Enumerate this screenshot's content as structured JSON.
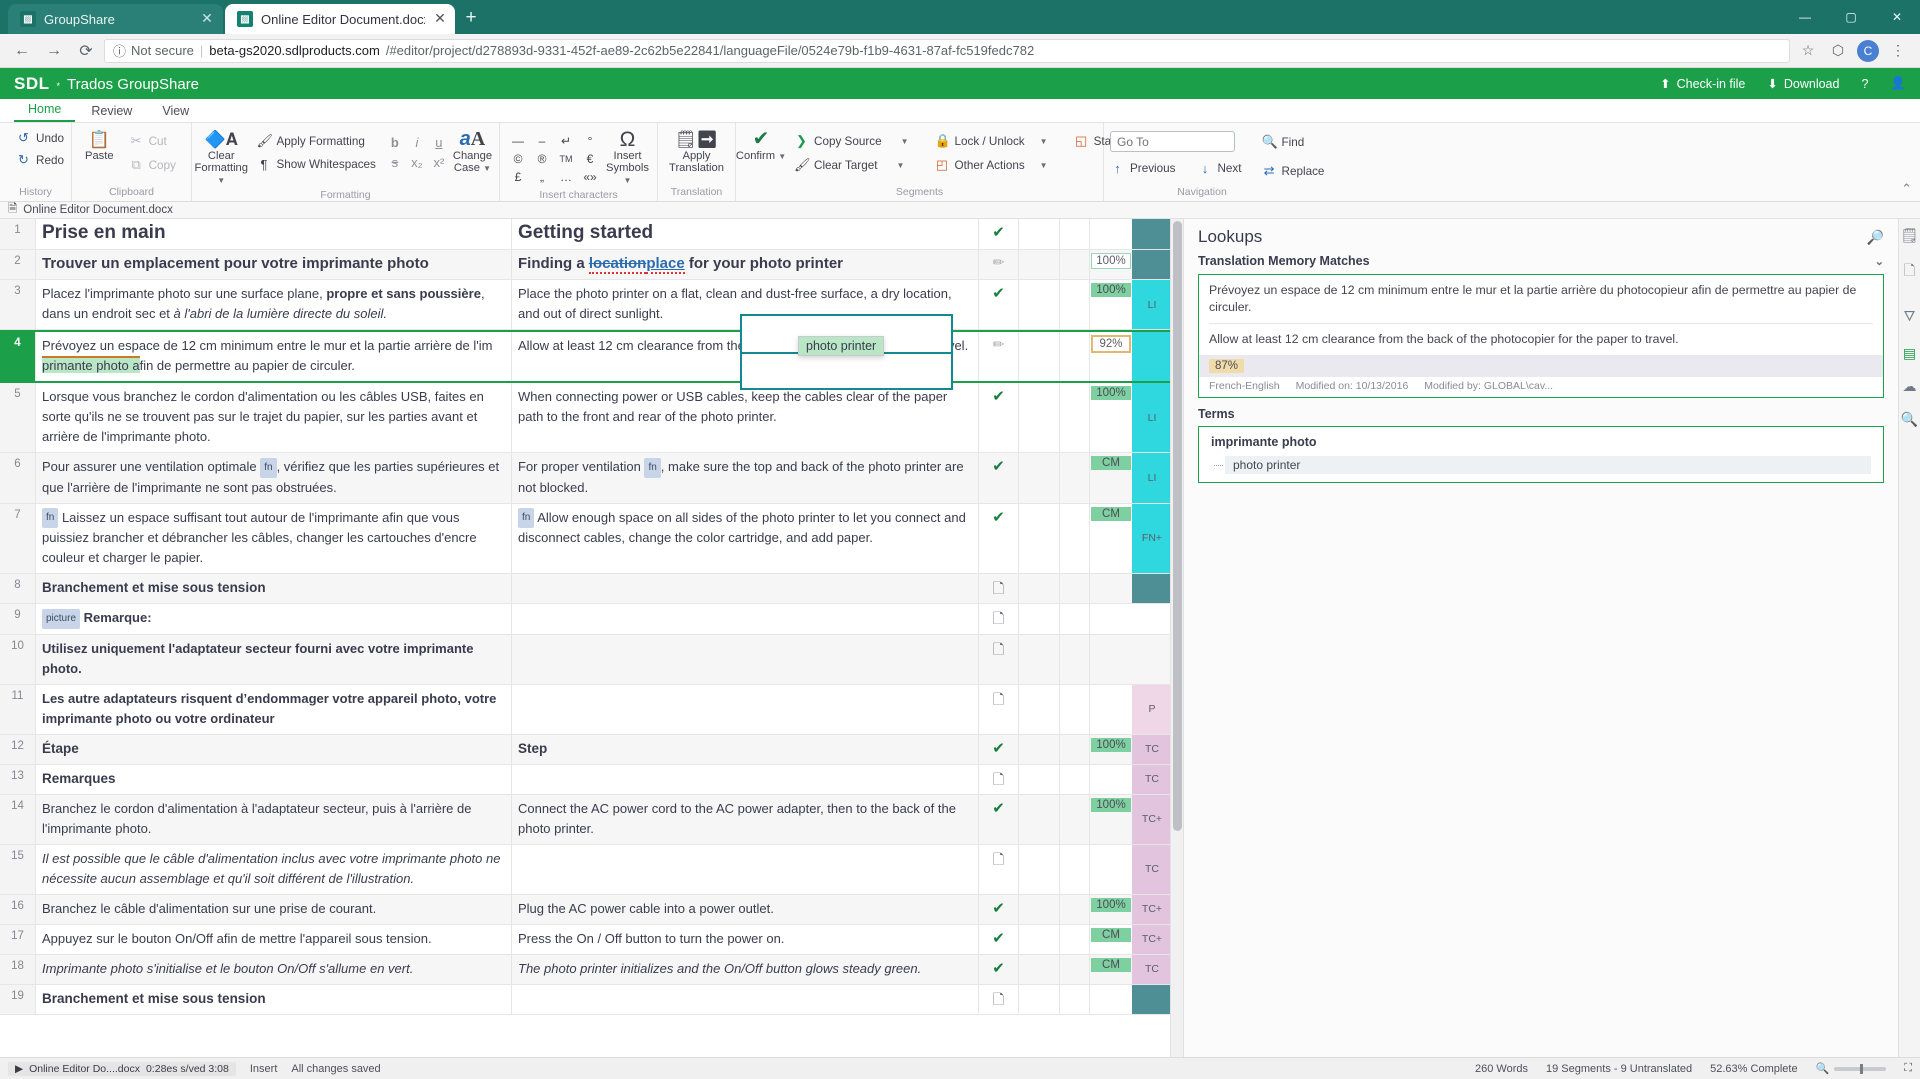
{
  "browser": {
    "tabs": [
      {
        "title": "GroupShare",
        "favicon": "trados-icon",
        "active": false
      },
      {
        "title": "Online Editor Document.docx.sd",
        "favicon": "trados-icon",
        "active": true
      }
    ],
    "new_tab_label": "+",
    "window_controls": [
      "minimize",
      "maximize",
      "close"
    ],
    "nav": {
      "back": "back-icon",
      "forward": "forward-icon",
      "reload": "reload-icon"
    },
    "omnibox": {
      "security_label": "Not secure",
      "url_host": "beta-gs2020.sdlproducts.com",
      "url_path": "/#editor/project/d278893d-9331-452f-ae89-2c62b5e22841/languageFile/0524e79b-f1b9-4631-87af-fc519fedc782"
    },
    "toolbar_icons": [
      "star-icon",
      "extension-icon",
      "profile-avatar",
      "menu-icon"
    ],
    "profile_initial": "C"
  },
  "app": {
    "brand_sdl": "SDL",
    "brand_sup": "*",
    "brand_product": "Trados GroupShare",
    "header_actions": [
      {
        "label": "Check-in file",
        "icon": "upload-icon"
      },
      {
        "label": "Download",
        "icon": "download-icon"
      },
      {
        "label": "",
        "icon": "help-icon"
      },
      {
        "label": "",
        "icon": "user-icon"
      }
    ]
  },
  "ribbon": {
    "tabs": [
      {
        "label": "Home",
        "active": true
      },
      {
        "label": "Review",
        "active": false
      },
      {
        "label": "View",
        "active": false
      }
    ],
    "collapse_icon": "chevron-up-icon",
    "groups": [
      {
        "name": "History",
        "buttons": [
          {
            "label": "Undo",
            "icon": "undo-icon",
            "disabled": false
          },
          {
            "label": "Redo",
            "icon": "redo-icon",
            "disabled": false
          }
        ]
      },
      {
        "name": "Clipboard",
        "big": {
          "label": "Paste",
          "icon": "paste-icon"
        },
        "buttons": [
          {
            "label": "Cut",
            "icon": "scissors-icon",
            "disabled": true
          },
          {
            "label": "Copy",
            "icon": "copy-icon",
            "disabled": true
          }
        ]
      },
      {
        "name": "Formatting",
        "big": {
          "label": "Clear Formatting",
          "icon": "clear-formatting-icon",
          "caret": true
        },
        "buttons": [
          {
            "label": "Apply Formatting",
            "icon": "format-painter-icon"
          },
          {
            "label": "Show Whitespaces",
            "icon": "pilcrow-icon"
          }
        ],
        "format_glyphs": [
          "b",
          "i",
          "u",
          "s",
          "x₂",
          "x²"
        ],
        "change_case": {
          "label": "Change Case",
          "icon": "aA-icon",
          "caret": true
        }
      },
      {
        "name": "Insert characters",
        "char_glyphs": [
          "—",
          "–",
          "↵",
          "°",
          "©",
          "®",
          "TM",
          "€",
          "£",
          "„",
          "…",
          "«»"
        ],
        "big": {
          "label": "Insert Symbols",
          "icon": "omega-icon",
          "caret": true
        }
      },
      {
        "name": "Translation",
        "big": {
          "label": "Apply Translation",
          "icon": "apply-translation-icon"
        }
      },
      {
        "name": "Segments",
        "big": {
          "label": "Confirm",
          "icon": "check-icon",
          "caret": true
        },
        "buttons": [
          {
            "label": "Copy Source",
            "icon": "copy-source-icon",
            "caret": true
          },
          {
            "label": "Clear Target",
            "icon": "clear-target-icon",
            "caret": true
          },
          {
            "label": "Lock / Unlock",
            "icon": "lock-icon",
            "caret": true
          },
          {
            "label": "Other Actions",
            "icon": "other-actions-icon",
            "caret": true
          },
          {
            "label": "Status",
            "icon": "status-icon",
            "caret": true
          }
        ]
      },
      {
        "name": "Navigation",
        "goto_placeholder": "Go To",
        "goto_value": "",
        "buttons": [
          {
            "label": "Find",
            "icon": "search-icon"
          },
          {
            "label": "Replace",
            "icon": "replace-icon"
          },
          {
            "label": "Previous",
            "icon": "arrow-up-icon"
          },
          {
            "label": "Next",
            "icon": "arrow-down-icon"
          }
        ]
      }
    ]
  },
  "document": {
    "tab_label": "Online Editor Document.docx",
    "tab_icon": "document-icon"
  },
  "segments": [
    {
      "num": "1",
      "source_html": "<span class=\"head1\">Prise en main</span>",
      "target_html": "<span class=\"head1\">Getting started</span>",
      "source_text": "Prise en main",
      "target_text": "Getting started",
      "status": "confirmed",
      "match": "",
      "match_style": "",
      "tag": "",
      "tag_style": "tag-dark",
      "alt": false
    },
    {
      "num": "2",
      "source_html": "<span class=\"head2\">Trouver un emplacement pour votre imprimante photo</span>",
      "target_html": "<span class=\"head2\">Finding a <span class=\"trk-del sq\">location</span><span class=\"trk-ins sq\">place</span> for your photo printer</span>",
      "source_text": "Trouver un emplacement pour votre imprimante photo",
      "target_text": "Finding a locationplace for your photo printer",
      "status": "draft",
      "match": "100%",
      "match_style": "pct-outline",
      "tag": "",
      "tag_style": "tag-dark",
      "alt": true
    },
    {
      "num": "3",
      "source_html": "Placez l'imprimante photo sur une surface plane, <b class=\"bb\">propre et sans poussière</b>, dans un endroit sec et <i class=\"ii\">à l'abri de la lumière directe du soleil.</i>",
      "target_html": "Place the photo printer on a flat, clean and dust-free surface, a dry location, and out of direct sunlight.",
      "source_text": "Placez l'imprimante photo sur une surface plane, propre et sans poussière, dans un endroit sec et à l'abri de la lumière directe du soleil.",
      "target_text": "Place the photo printer on a flat, clean and dust-free surface, a dry location, and out of direct sunlight.",
      "status": "confirmed",
      "match": "100%",
      "match_style": "pct-green",
      "tag": "LI",
      "tag_style": "tag-li",
      "alt": false
    },
    {
      "num": "4",
      "source_html": "Prévoyez un espace de 12 cm minimum entre le mur et la partie arrière de l'im<br><span class=\"tm-hl\">primante photo a</span>fin de permettre au papier de circuler.",
      "target_html": "Allow at least 12 cm clearance from the back of the pho for the paper to travel.",
      "source_text": "Prévoyez un espace de 12 cm minimum entre le mur et la partie arrière de l'imprimante photo afin de permettre au papier de circuler.",
      "target_text": "Allow at least 12 cm clearance from the back of the pho for the paper to travel.",
      "status": "draft",
      "match": "92%",
      "match_style": "pct-amber",
      "tag": "",
      "tag_style": "tag-cy",
      "alt": false,
      "active": true,
      "autocomplete": "photo printer"
    },
    {
      "num": "5",
      "source_html": "Lorsque vous branchez le cordon d'alimentation ou les câbles USB, faites en sorte qu'ils ne se trouvent pas sur le trajet du papier, sur les parties avant et arrière de l'imprimante photo.",
      "target_html": "When connecting power or USB cables, keep the cables clear of the paper path to the front and rear of the photo printer.",
      "source_text": "Lorsque vous branchez le cordon d'alimentation ou les câbles USB, faites en sorte qu'ils ne se trouvent pas sur le trajet du papier, sur les parties avant et arrière de l'imprimante photo.",
      "target_text": "When connecting power or USB cables, keep the cables clear of the paper path to the front and rear of the photo printer.",
      "status": "confirmed",
      "match": "100%",
      "match_style": "pct-green",
      "tag": "LI",
      "tag_style": "tag-li",
      "alt": false
    },
    {
      "num": "6",
      "source_html": "Pour assurer une ventilation optimale <span class=\"tagchip\">fn</span>, vérifiez que les parties supérieures et que l'arrière de l'imprimante ne sont pas obstruées.",
      "target_html": "For proper ventilation <span class=\"tagchip\">fn</span>, make sure the top and back of the photo printer are not blocked.",
      "source_text": "Pour assurer une ventilation optimale fn, vérifiez que les parties supérieures et que l'arrière de l'imprimante ne sont pas obstruées.",
      "target_text": "For proper ventilation fn, make sure the top and back of the photo printer are not blocked.",
      "status": "confirmed",
      "match": "CM",
      "match_style": "pct-green",
      "tag": "LI",
      "tag_style": "tag-li",
      "alt": true
    },
    {
      "num": "7",
      "source_html": "<span class=\"tagchip\">fn</span> Laissez un espace suffisant tout autour de l'imprimante afin que vous puissiez brancher et débrancher les câbles, changer les cartouches d'encre couleur et charger le papier.",
      "target_html": "<span class=\"tagchip\">fn</span> Allow enough space on all sides of the photo printer to let you connect and disconnect cables, change the color cartridge, and add paper.",
      "source_text": "fn Laissez un espace suffisant tout autour de l'imprimante afin que vous puissiez brancher et débrancher les câbles, changer les cartouches d'encre couleur et charger le papier.",
      "target_text": "fn Allow enough space on all sides of the photo printer to let you connect and disconnect cables, change the color cartridge, and add paper.",
      "status": "confirmed",
      "match": "CM",
      "match_style": "pct-green",
      "tag": "FN+",
      "tag_style": "tag-li",
      "alt": false
    },
    {
      "num": "8",
      "source_html": "<span class=\"head3\">Branchement et mise sous tension</span>",
      "target_html": "",
      "source_text": "Branchement et mise sous tension",
      "target_text": "",
      "status": "untranslated",
      "match": "",
      "match_style": "",
      "tag": "",
      "tag_style": "tag-dark",
      "alt": true
    },
    {
      "num": "9",
      "source_html": "<span class=\"tagchip\">picture</span> <b class=\"bb\">Remarque:</b>",
      "target_html": "",
      "source_text": "picture Remarque:",
      "target_text": "",
      "status": "untranslated",
      "match": "",
      "match_style": "",
      "tag": "",
      "tag_style": "",
      "alt": false
    },
    {
      "num": "10",
      "source_html": "<b class=\"bb\">Utilisez uniquement l'adaptateur secteur fourni avec votre imprimante photo.</b>",
      "target_html": "",
      "source_text": "Utilisez uniquement l'adaptateur secteur fourni avec votre imprimante photo.",
      "target_text": "",
      "status": "untranslated",
      "match": "",
      "match_style": "",
      "tag": "",
      "tag_style": "",
      "alt": true
    },
    {
      "num": "11",
      "source_html": "<b class=\"bb\">Les autre adaptateurs risquent d’endommager votre appareil photo, votre imprimante photo ou votre ordinateur</b>",
      "target_html": "",
      "source_text": "Les autre adaptateurs risquent d’endommager votre appareil photo, votre imprimante photo ou votre ordinateur",
      "target_text": "",
      "status": "untranslated",
      "match": "",
      "match_style": "",
      "tag": "P",
      "tag_style": "tag-p",
      "alt": false
    },
    {
      "num": "12",
      "source_html": "<span class=\"head3\">Étape</span>",
      "target_html": "<span class=\"head3\">Step</span>",
      "source_text": "Étape",
      "target_text": "Step",
      "status": "confirmed",
      "match": "100%",
      "match_style": "pct-green",
      "tag": "TC",
      "tag_style": "tag-tc",
      "alt": true
    },
    {
      "num": "13",
      "source_html": "<span class=\"head3\">Remarques</span>",
      "target_html": "",
      "source_text": "Remarques",
      "target_text": "",
      "status": "untranslated",
      "match": "",
      "match_style": "",
      "tag": "TC",
      "tag_style": "tag-tc",
      "alt": false
    },
    {
      "num": "14",
      "source_html": "Branchez le cordon d'alimentation à l'adaptateur secteur, puis à l'arrière de l'imprimante photo.",
      "target_html": "Connect the AC power cord to the AC power adapter, then to the back of the photo printer.",
      "source_text": "Branchez le cordon d'alimentation à l'adaptateur secteur, puis à l'arrière de l'imprimante photo.",
      "target_text": "Connect the AC power cord to the AC power adapter, then to the back of the photo printer.",
      "status": "confirmed",
      "match": "100%",
      "match_style": "pct-green",
      "tag": "TC+",
      "tag_style": "tag-tc",
      "alt": true
    },
    {
      "num": "15",
      "source_html": "<i class=\"ii\">Il est possible que le câble d'alimentation inclus avec votre imprimante photo ne nécessite aucun assemblage et qu'il soit différent de l'illustration.</i>",
      "target_html": "",
      "source_text": "Il est possible que le câble d'alimentation inclus avec votre imprimante photo ne nécessite aucun assemblage et qu'il soit différent de l'illustration.",
      "target_text": "",
      "status": "untranslated",
      "match": "",
      "match_style": "",
      "tag": "TC",
      "tag_style": "tag-tc",
      "alt": false
    },
    {
      "num": "16",
      "source_html": "Branchez le câble d'alimentation sur une prise de courant.",
      "target_html": "Plug the AC power cable into a power outlet.",
      "source_text": "Branchez le câble d'alimentation sur une prise de courant.",
      "target_text": "Plug the AC power cable into a power outlet.",
      "status": "confirmed",
      "match": "100%",
      "match_style": "pct-green",
      "tag": "TC+",
      "tag_style": "tag-tc",
      "alt": true
    },
    {
      "num": "17",
      "source_html": "Appuyez sur le bouton On/Off afin de mettre l'appareil sous tension.",
      "target_html": "Press the On / Off button to turn the power on.",
      "source_text": "Appuyez sur le bouton On/Off afin de mettre l'appareil sous tension.",
      "target_text": "Press the On / Off button to turn the power on.",
      "status": "confirmed",
      "match": "CM",
      "match_style": "pct-green",
      "tag": "TC+",
      "tag_style": "tag-tc",
      "alt": false
    },
    {
      "num": "18",
      "source_html": "<i class=\"ii\">Imprimante photo s'initialise et le bouton On/Off s'allume en vert.</i>",
      "target_html": "<i class=\"ii\">The photo printer initializes and the On/Off button glows steady green.</i>",
      "source_text": "Imprimante photo s'initialise et le bouton On/Off s'allume en vert.",
      "target_text": "The photo printer initializes and the On/Off button glows steady green.",
      "status": "confirmed",
      "match": "CM",
      "match_style": "pct-green",
      "tag": "TC",
      "tag_style": "tag-tc",
      "alt": true
    },
    {
      "num": "19",
      "source_html": "<span class=\"head3\">Branchement et mise sous tension</span>",
      "target_html": "",
      "source_text": "Branchement et mise sous tension",
      "target_text": "",
      "status": "untranslated",
      "match": "",
      "match_style": "",
      "tag": "",
      "tag_style": "tag-dark",
      "alt": false
    }
  ],
  "lookups": {
    "title": "Lookups",
    "search_icon": "search-icon",
    "tm_section_title": "Translation Memory Matches",
    "collapse_icon": "chevron-down-icon",
    "tm_match": {
      "source": "Prévoyez un espace de 12 cm minimum entre le mur et la partie arrière du photocopieur afin de permettre au papier de circuler.",
      "target": "Allow at least 12 cm clearance from the back of the photocopier for the paper to travel.",
      "score": "87%",
      "language_pair": "French-English",
      "modified_on_label": "Modified on: 10/13/2016",
      "modified_by_label": "Modified by: GLOBAL\\cav..."
    },
    "terms_title": "Terms",
    "terms": [
      {
        "source": "imprimante photo",
        "target": "photo printer"
      }
    ]
  },
  "rail_icons": [
    "notes-icon",
    "comments-icon",
    "filter-icon",
    "tm-icon",
    "messages-icon",
    "search2-icon"
  ],
  "statusbar": {
    "download_label": "Online Editor Do....docx",
    "download_progress": "0:28es s/ved 3:08",
    "insert_mode": "Insert",
    "all_changes": "All changes saved",
    "word_count": "260 Words",
    "segment_count": "19 Segments - 9 Untranslated",
    "completion": "52.63% Complete",
    "zoom_icon": "zoom-icon",
    "fullscreen_icon": "fullscreen-icon"
  }
}
